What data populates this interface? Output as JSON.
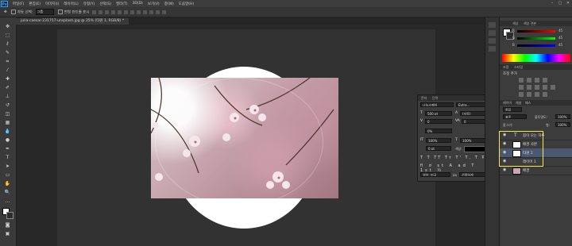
{
  "app": {
    "logo_text": "Ps"
  },
  "menu": [
    "파일(F)",
    "편집(E)",
    "이미지(I)",
    "레이어(L)",
    "유형(Y)",
    "선택(S)",
    "필터(T)",
    "3D(D)",
    "보기(V)",
    "창(W)",
    "도움말(H)"
  ],
  "window_controls": [
    "–",
    "▢",
    "✕"
  ],
  "options_bar": {
    "auto_select_label": "자동 선택:",
    "auto_select_value": "그룹",
    "transform_controls_label": "변형 컨트롤 표시"
  },
  "document": {
    "tab_title": "julia-caesar-231757-unsplash.jpg @ 25% (타원 1, RGB/8) *"
  },
  "character_panel": {
    "tabs": [
      "문자",
      "단락"
    ],
    "font_family": "나눔스퀘어",
    "font_style": "Extra...",
    "font_size": "500 pt",
    "leading": "(자동)",
    "kerning": "0",
    "tracking": "0",
    "scale_label": "0%",
    "vertical_scale": "100%",
    "horizontal_scale": "100%",
    "baseline_shift": "0 pt",
    "color_label": "색상:",
    "language": "영어: 미국",
    "antialias": "선명하게",
    "aa_label": "aa"
  },
  "color_panel": {
    "tabs": [
      "색상",
      "색상 견본"
    ],
    "channels": [
      {
        "label": "R",
        "value": "45"
      },
      {
        "label": "G",
        "value": "45"
      },
      {
        "label": "B",
        "value": "45"
      }
    ]
  },
  "adjust_panel": {
    "tabs": [
      "조정",
      "스타일"
    ],
    "title": "조정 추가"
  },
  "layers_panel": {
    "tabs": [
      "레이어",
      "채널",
      "패스"
    ],
    "kind_label": "종류",
    "blend_mode": "표준",
    "opacity_label": "불투명도:",
    "opacity_value": "100%",
    "lock_label": "잠그기:",
    "fill_label": "칠:",
    "fill_value": "100%",
    "layers": [
      {
        "type_icon": "T",
        "name": "봄이 오는 하루"
      },
      {
        "type_icon": "",
        "name": "배경 사본"
      },
      {
        "type_icon": "",
        "name": "타원 1"
      },
      {
        "type_icon": "",
        "name": "레이어 1"
      },
      {
        "type_icon": "",
        "name": "배경"
      }
    ]
  },
  "highlight_color": "#f5e94a"
}
